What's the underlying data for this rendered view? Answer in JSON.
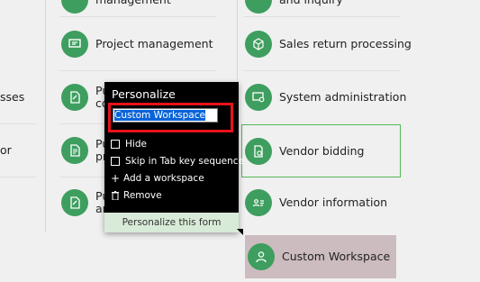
{
  "left_cut": {
    "item1": "sses",
    "item2": "or"
  },
  "col2": {
    "item0": "management",
    "item1": "Project management",
    "item2_partial": [
      "Pu",
      "co"
    ],
    "item3_partial": [
      "Pu",
      "pr"
    ],
    "item4_partial": [
      "Pu",
      "an"
    ]
  },
  "col3": {
    "item0": "and inquiry",
    "item1": "Sales return processing",
    "item2": "System administration",
    "item3": "Vendor bidding",
    "item4": "Vendor information",
    "item5": "Custom Workspace"
  },
  "popup": {
    "title": "Personalize",
    "workspace_value": "Custom Workspace",
    "hide": "Hide",
    "skip_tab": "Skip in Tab key sequence",
    "add_workspace": "Add a workspace",
    "remove": "Remove",
    "footer": "Personalize this form"
  },
  "icons": {
    "project": "presentation-board-icon",
    "document": "document-edit-icon",
    "cube": "cube-icon",
    "system": "monitor-gear-icon",
    "bidding": "document-clock-icon",
    "vendor": "contact-card-icon",
    "person": "person-icon",
    "plus": "plus-icon",
    "trash": "trash-icon"
  },
  "colors": {
    "tile_icon": "#3e9e5f",
    "highlight": "#cdbcbf",
    "selected_border": "#56b756",
    "red_frame": "#e8121a"
  }
}
